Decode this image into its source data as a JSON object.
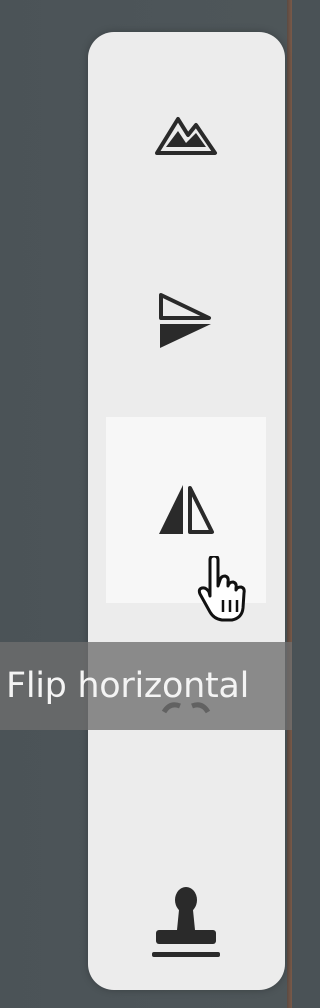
{
  "toolbar": {
    "tools": [
      {
        "name": "landscape",
        "icon": "mountain-icon"
      },
      {
        "name": "flip-vertical",
        "icon": "flip-vertical-icon"
      },
      {
        "name": "flip-horizontal",
        "icon": "flip-horizontal-icon",
        "hovered": true
      },
      {
        "name": "rotate",
        "icon": "rotate-icon"
      },
      {
        "name": "stamp",
        "icon": "stamp-icon"
      }
    ]
  },
  "tooltip": {
    "text": "Flip horizontal"
  },
  "colors": {
    "background": "#4b5357",
    "toolbar": "#ececec",
    "icon": "#2a2a2a",
    "tooltip_bg": "#6e6e6e",
    "tooltip_text": "#f4f4f4"
  },
  "cursor": {
    "icon": "hand-pointer-icon"
  }
}
